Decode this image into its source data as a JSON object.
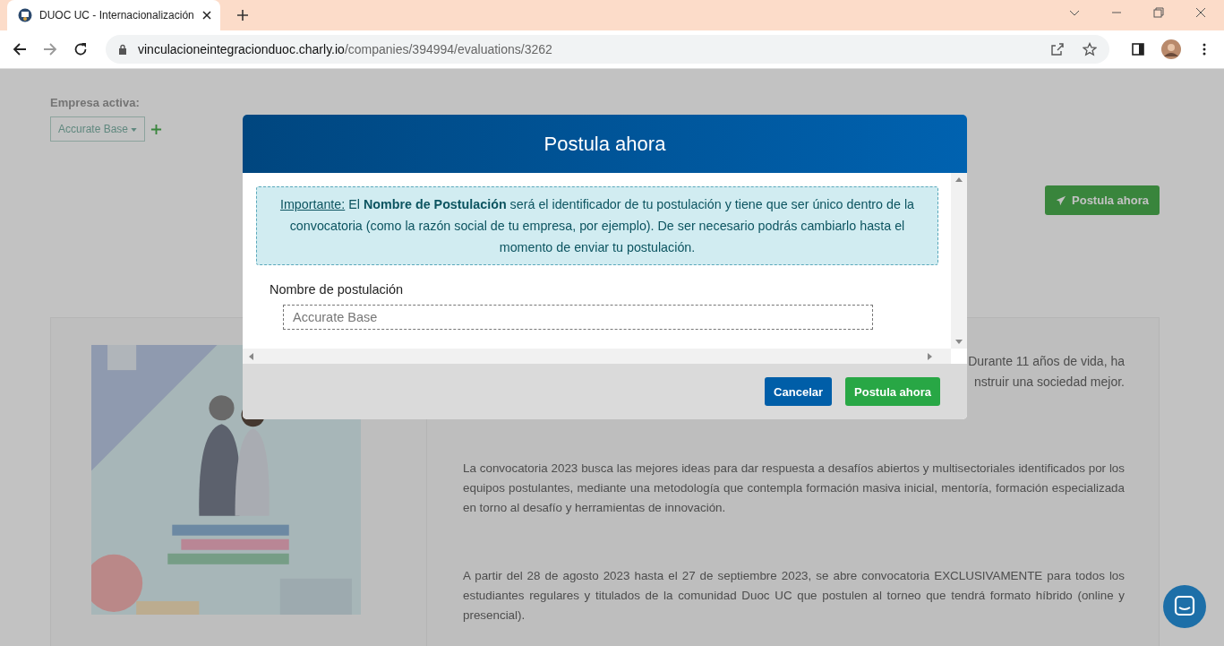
{
  "browser": {
    "tab": {
      "title": "DUOC UC - Internacionalización",
      "selected": true
    },
    "url": {
      "host": "vinculacioneintegracionduoc.charly.io",
      "path": "/companies/394994/evaluations/3262"
    }
  },
  "page": {
    "company_label": "Empresa activa:",
    "company_select": "Accurate Base",
    "apply_button": "Postula ahora",
    "intro_fragments": [
      "Durante 11 años de vida, ha",
      "nstruir una sociedad mejor."
    ],
    "paragraphs": [
      "La convocatoria 2023 busca las mejores ideas para dar respuesta a desafíos abiertos y multisectoriales identificados por los equipos postulantes, mediante una metodología que contempla formación masiva inicial, mentoría, formación especializada en torno al desafío y herramientas de innovación.",
      "A partir del 28 de agosto 2023 hasta el 27 de septiembre 2023, se abre convocatoria EXCLUSIVAMENTE para todos los estudiantes regulares y titulados de la comunidad Duoc UC que postulen al torneo que tendrá formato híbrido (online y presencial)."
    ]
  },
  "modal": {
    "title": "Postula ahora",
    "notice": {
      "label": "Importante:",
      "text": "El **Nombre de Postulación** será el identificador de tu postulación y tiene que ser único dentro de la convocatoria (como la razón social de tu empresa, por ejemplo). De ser necesario podrás cambiarlo hasta el momento de enviar tu postulación."
    },
    "field": {
      "label": "Nombre de postulación",
      "placeholder": "Accurate Base"
    },
    "buttons": [
      {
        "label": "Cancelar",
        "kind": "secondary"
      },
      {
        "label": "Postula ahora",
        "kind": "primary"
      }
    ]
  }
}
